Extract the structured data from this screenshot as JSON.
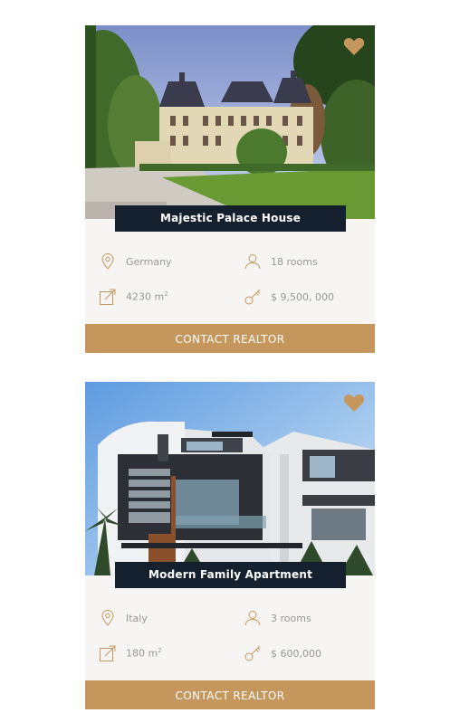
{
  "listings": [
    {
      "title": "Majestic Palace House",
      "location": "Germany",
      "rooms": "18 rooms",
      "area_value": "4230 m",
      "area_unit_sup": "2",
      "price": "$ 9,500, 000",
      "cta": "CONTACT REALTOR",
      "icons": {
        "favorite": "heart-icon",
        "location": "location-pin-icon",
        "rooms": "person-icon",
        "area": "area-resize-icon",
        "price": "key-icon"
      }
    },
    {
      "title": "Modern Family Apartment",
      "location": "Italy",
      "rooms": "3 rooms",
      "area_value": "180 m",
      "area_unit_sup": "2",
      "price": "$ 600,000",
      "cta": "CONTACT REALTOR",
      "icons": {
        "favorite": "heart-icon",
        "location": "location-pin-icon",
        "rooms": "person-icon",
        "area": "area-resize-icon",
        "price": "key-icon"
      }
    }
  ],
  "colors": {
    "accent": "#c6975d",
    "title_bar": "#14202e",
    "card_bg": "#f7f5f3",
    "feature_text": "#9a9692"
  }
}
